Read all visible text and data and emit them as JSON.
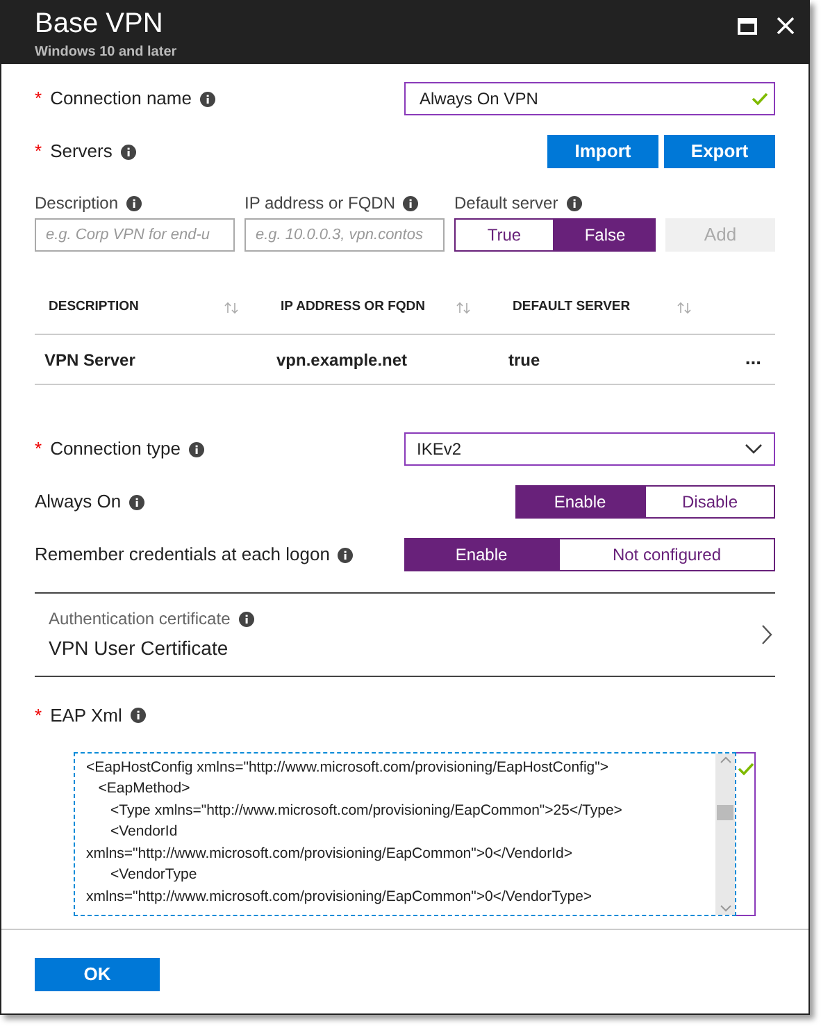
{
  "window": {
    "title": "Base VPN",
    "subtitle": "Windows 10 and later"
  },
  "connection_name": {
    "label": "Connection name",
    "required_mark": "*",
    "value": "Always On VPN",
    "valid": true
  },
  "servers": {
    "label": "Servers",
    "required_mark": "*",
    "buttons": [
      "Import",
      "Export"
    ],
    "fields": [
      {
        "label": "Description",
        "placeholder": "e.g. Corp VPN for end-u"
      },
      {
        "label": "IP address or FQDN",
        "placeholder": "e.g. 10.0.0.3, vpn.contos"
      }
    ],
    "default_server": {
      "label": "Default server",
      "options": [
        {
          "label": "True",
          "selected": false
        },
        {
          "label": "False",
          "selected": true
        }
      ]
    },
    "add_button": {
      "label": "Add",
      "disabled": true
    },
    "table": {
      "columns": [
        "DESCRIPTION",
        "IP ADDRESS OR FQDN",
        "DEFAULT SERVER"
      ],
      "rows": [
        {
          "cells": [
            "VPN Server",
            "vpn.example.net",
            "true"
          ],
          "menu": "..."
        }
      ]
    }
  },
  "connection_type": {
    "label": "Connection type",
    "required_mark": "*",
    "value": "IKEv2"
  },
  "always_on": {
    "label": "Always On",
    "options": [
      {
        "label": "Enable",
        "selected": true
      },
      {
        "label": "Disable",
        "selected": false
      }
    ]
  },
  "remember_credentials": {
    "label": "Remember credentials at each logon",
    "options": [
      {
        "label": "Enable",
        "selected": true
      },
      {
        "label": "Not configured",
        "selected": false
      }
    ]
  },
  "authentication_certificate": {
    "label": "Authentication certificate",
    "value": "VPN User Certificate"
  },
  "eap_xml": {
    "label": "EAP Xml",
    "required_mark": "*",
    "valid": true,
    "lines": [
      "<EapHostConfig xmlns=\"http://www.microsoft.com/provisioning/EapHostConfig\">",
      "   <EapMethod>",
      "      <Type xmlns=\"http://www.microsoft.com/provisioning/EapCommon\">25</Type>",
      "      <VendorId",
      "xmlns=\"http://www.microsoft.com/provisioning/EapCommon\">0</VendorId>",
      "      <VendorType",
      "xmlns=\"http://www.microsoft.com/provisioning/EapCommon\">0</VendorType>"
    ]
  },
  "ok_button": "OK"
}
